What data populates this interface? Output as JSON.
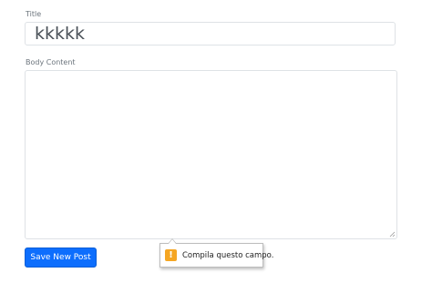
{
  "form": {
    "title_label": "Title",
    "title_value": "kkkkk",
    "body_label": "Body Content",
    "body_value": "",
    "save_label": "Save New Post"
  },
  "validation": {
    "message": "Compila questo campo.",
    "icon": "warning-icon",
    "icon_glyph": "!",
    "icon_color": "#f5a623"
  },
  "colors": {
    "primary": "#0d6efd",
    "label": "#6c757d",
    "border": "#dee2e6"
  }
}
